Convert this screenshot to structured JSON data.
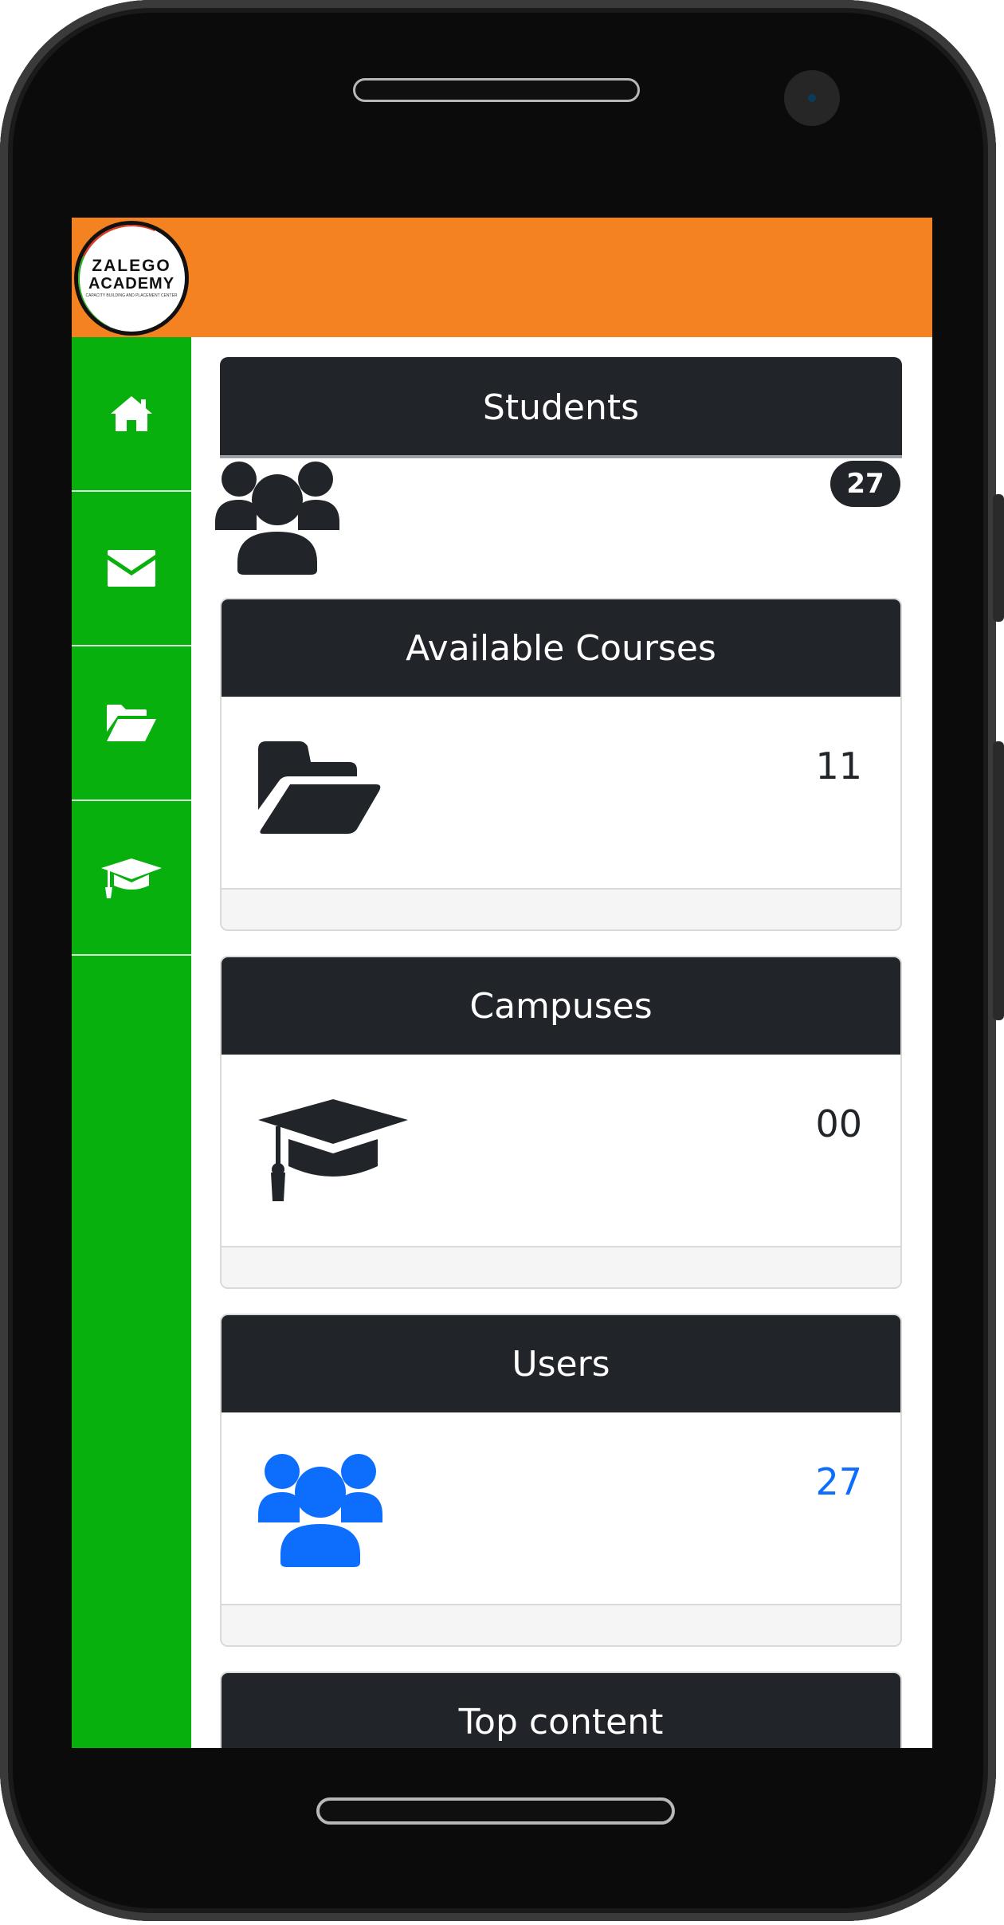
{
  "app": {
    "logo": {
      "line1": "ZALEGO",
      "line2": "ACADEMY",
      "tagline": "CAPACITY BUILDING AND PLACEMENT CENTER"
    }
  },
  "sidebar": {
    "items": [
      {
        "icon": "home-icon"
      },
      {
        "icon": "envelope-icon"
      },
      {
        "icon": "folder-open-icon"
      },
      {
        "icon": "graduation-cap-icon"
      }
    ]
  },
  "colors": {
    "header": "#f58220",
    "sidebar": "#08b00e",
    "card_header": "#212529",
    "accent_blue": "#0d6efd"
  },
  "students": {
    "title": "Students",
    "badge": "27",
    "icon": "users-icon"
  },
  "cards": [
    {
      "title": "Available Courses",
      "count": "11",
      "icon": "folder-open-icon"
    },
    {
      "title": "Campuses",
      "count": "00",
      "icon": "graduation-cap-icon"
    },
    {
      "title": "Users",
      "count": "27",
      "icon": "users-icon"
    },
    {
      "title": "Top content"
    }
  ]
}
